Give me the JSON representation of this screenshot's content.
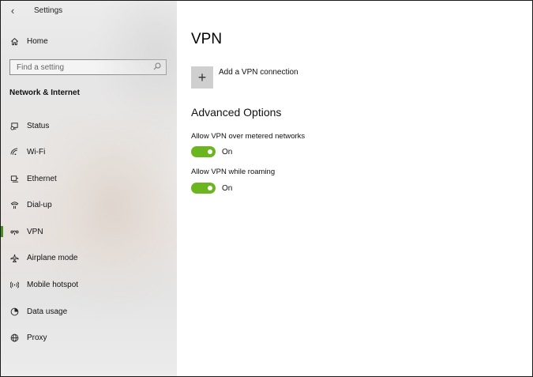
{
  "window": {
    "title": "Settings",
    "back_icon": "back-arrow-icon"
  },
  "sidebar": {
    "home_label": "Home",
    "search_placeholder": "Find a setting",
    "section_title": "Network & Internet",
    "active_item": "VPN",
    "items": [
      {
        "label": "Status",
        "icon": "status-icon"
      },
      {
        "label": "Wi-Fi",
        "icon": "wifi-icon"
      },
      {
        "label": "Ethernet",
        "icon": "ethernet-icon"
      },
      {
        "label": "Dial-up",
        "icon": "dialup-icon"
      },
      {
        "label": "VPN",
        "icon": "vpn-icon"
      },
      {
        "label": "Airplane mode",
        "icon": "airplane-icon"
      },
      {
        "label": "Mobile hotspot",
        "icon": "hotspot-icon"
      },
      {
        "label": "Data usage",
        "icon": "data-usage-icon"
      },
      {
        "label": "Proxy",
        "icon": "proxy-icon"
      }
    ]
  },
  "main": {
    "title": "VPN",
    "add_connection_label": "Add a VPN connection",
    "advanced_title": "Advanced Options",
    "options": [
      {
        "label": "Allow VPN over metered networks",
        "state": "On",
        "on": true
      },
      {
        "label": "Allow VPN while roaming",
        "state": "On",
        "on": true
      }
    ]
  },
  "colors": {
    "accent": "#6bb51e",
    "active_indicator": "#4a8d1f"
  }
}
